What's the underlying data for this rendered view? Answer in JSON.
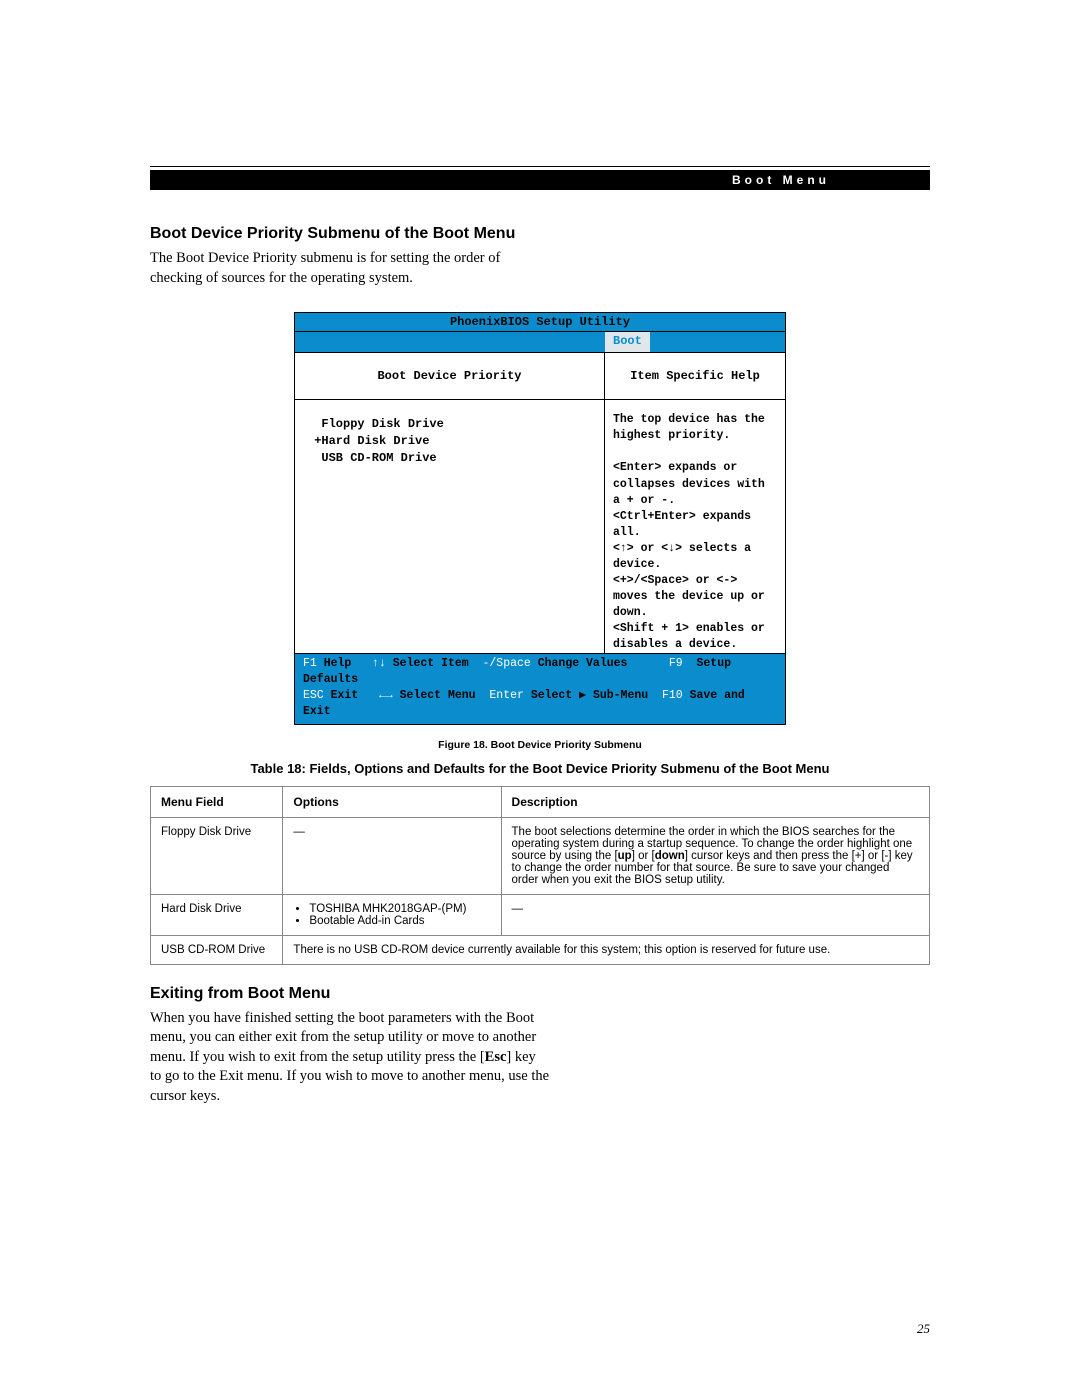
{
  "header_label": "Boot Menu",
  "section1": {
    "heading": "Boot Device Priority Submenu of the Boot Menu",
    "para": "The Boot Device Priority submenu is for setting the order of checking of sources for the operating system."
  },
  "bios": {
    "title": "PhoenixBIOS Setup Utility",
    "tab": "Boot",
    "left_title": "Boot Device Priority",
    "right_title": "Item Specific Help",
    "devices": "  Floppy Disk Drive\n +Hard Disk Drive\n  USB CD-ROM Drive",
    "help_text": "The top device has the highest priority.\n\n<Enter> expands or collapses devices with a + or -.\n<Ctrl+Enter> expands all.\n<↑> or <↓> selects a device.\n<+>/<Space> or <-> moves the device up or down.\n<Shift + 1> enables or disables a device.",
    "foot_line1_html": "<span class=\"fk\">F1 </span><span class=\"bk\">Help</span>&nbsp;&nbsp;&nbsp;<span class=\"fk\">↑↓ </span><span class=\"bk\">Select Item</span>&nbsp;&nbsp;<span class=\"fk\">-/Space </span><span class=\"bk\">Change Values</span>&nbsp;&nbsp;&nbsp;&nbsp;&nbsp;&nbsp;<span class=\"fk\">F9 </span>&nbsp;<span class=\"bk\">Setup Defaults</span>",
    "foot_line2_html": "<span class=\"fk\">ESC </span><span class=\"bk\">Exit</span>&nbsp;&nbsp;&nbsp;<span class=\"fk\">←→ </span><span class=\"bk\">Select Menu</span>&nbsp;&nbsp;<span class=\"fk\">Enter </span><span class=\"bk\">Select ▶ Sub-Menu</span>&nbsp;&nbsp;<span class=\"fk\">F10 </span><span class=\"bk\">Save and Exit</span>"
  },
  "figure_caption": "Figure 18.  Boot Device Priority Submenu",
  "table_caption": "Table 18: Fields, Options and Defaults for the Boot Device Priority Submenu of the Boot Menu",
  "table": {
    "headers": [
      "Menu Field",
      "Options",
      "Description"
    ],
    "rows": [
      {
        "field": "Floppy Disk Drive",
        "options_html": "—",
        "desc": "The boot selections determine the order in which the BIOS searches for the operating system during a startup sequence. To change the order highlight one source by using the [up] or [down] cursor keys and then press the [+] or [-] key to change the order number for that source. Be sure to save your changed order when you exit the BIOS setup utility.",
        "colspan_desc": 1,
        "colspan_opts": 1
      },
      {
        "field": "Hard Disk Drive",
        "options_html": "<ul><li>TOSHIBA MHK2018GAP-(PM)</li><li>Bootable Add-in Cards</li></ul>",
        "desc": "—",
        "colspan_desc": 1,
        "colspan_opts": 1
      },
      {
        "field": "USB CD-ROM Drive",
        "options_html": "",
        "desc": "There is no USB CD-ROM device currently available for this system; this option is reserved for future use.",
        "colspan_desc": 2,
        "colspan_opts": 0
      }
    ]
  },
  "section2": {
    "heading": "Exiting from Boot Menu",
    "para_html": "When you have finished setting the boot parameters with the Boot menu, you can either exit from the setup utility or move to another menu. If you wish to exit from the setup utility press the [<b>Esc</b>] key to go to the Exit menu. If you wish to move to another menu, use the cursor keys."
  },
  "page_number": "25"
}
